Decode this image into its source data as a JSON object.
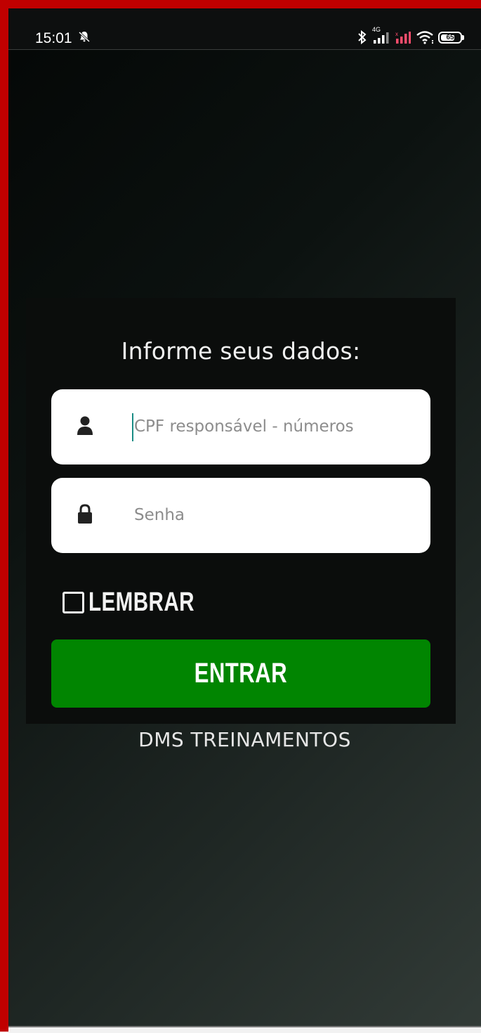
{
  "status_bar": {
    "time": "15:01",
    "network_label": "4G",
    "battery_level": "65"
  },
  "login": {
    "title": "Informe seus dados:",
    "cpf_placeholder": "CPF responsável - números",
    "cpf_value": "",
    "password_placeholder": "Senha",
    "password_value": "",
    "remember_label": "LEMBRAR",
    "remember_checked": false,
    "enter_button_label": "ENTRAR"
  },
  "footer": {
    "brand": "DMS TREINAMENTOS"
  },
  "colors": {
    "frame_red": "#c00000",
    "button_green": "#018501",
    "caret_teal": "#1a8c85"
  },
  "icons": {
    "status": [
      "dnd-icon",
      "bluetooth-icon",
      "signal-icon",
      "signal-no-service-icon",
      "wifi-icon",
      "battery-icon"
    ],
    "fields": [
      "user-icon",
      "lock-icon"
    ]
  }
}
